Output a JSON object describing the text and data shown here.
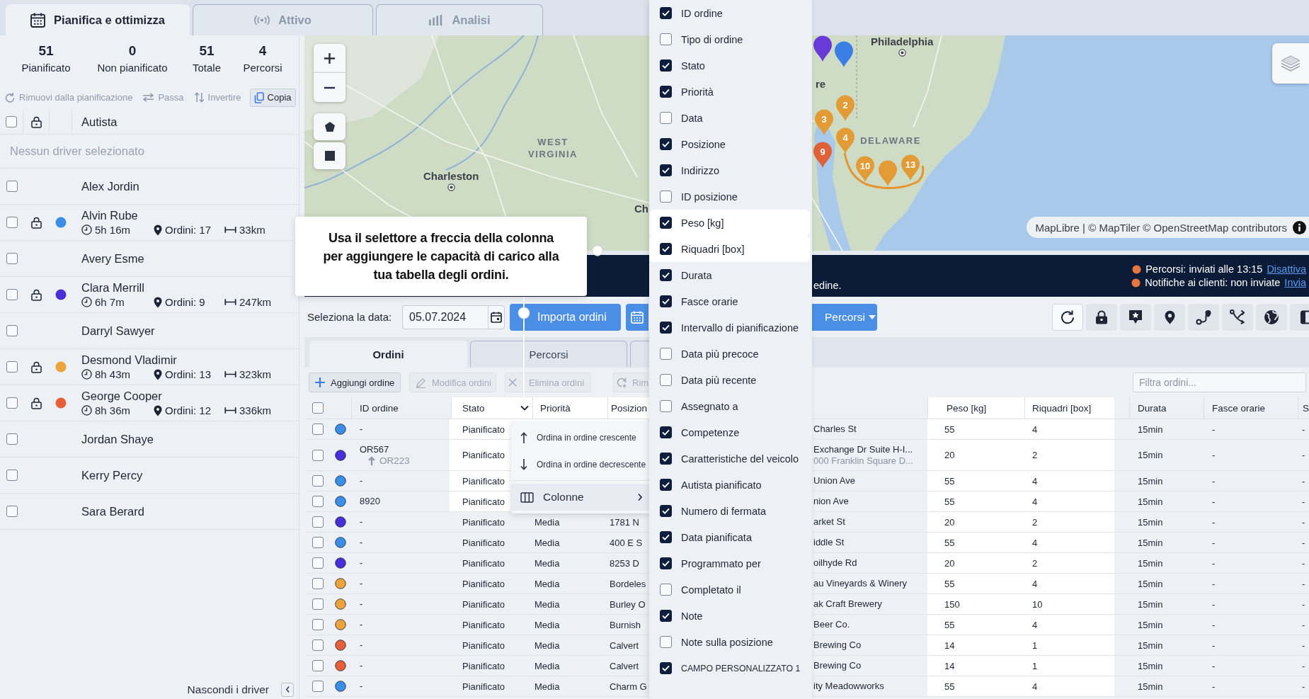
{
  "top_tabs": [
    {
      "label": "Pianifica e ottimizza",
      "selected": true
    },
    {
      "label": "Attivo",
      "selected": false
    },
    {
      "label": "Analisi",
      "selected": false
    }
  ],
  "summary": [
    {
      "value": "51",
      "label": "Pianificato"
    },
    {
      "value": "0",
      "label": "Non pianificato"
    },
    {
      "value": "51",
      "label": "Totale"
    },
    {
      "value": "4",
      "label": "Percorsi"
    }
  ],
  "driver_actions": [
    {
      "label": "Rimuovi dalla pianificazione",
      "disabled": true
    },
    {
      "label": "Passa",
      "disabled": true
    },
    {
      "label": "Invertire",
      "disabled": true
    },
    {
      "label": "Copia",
      "disabled": false
    }
  ],
  "drivers": {
    "all_checked": false,
    "column": "Autista",
    "placeholder": "Nessun driver selezionato",
    "hide_label": "Nascondi i driver",
    "rows": [
      {
        "name": "Alex Jordin",
        "checked": false
      },
      {
        "name": "Alvin Rube",
        "checked": false,
        "color": "#3a8ee6",
        "duration": "5h 16m",
        "orders": "Ordini: 17",
        "distance": "33km"
      },
      {
        "name": "Avery Esme",
        "checked": false
      },
      {
        "name": "Clara Merrill",
        "checked": false,
        "color": "#4a2fd8",
        "duration": "6h 7m",
        "orders": "Ordini: 9",
        "distance": "247km"
      },
      {
        "name": "Darryl Sawyer",
        "checked": false
      },
      {
        "name": "Desmond Vladimir",
        "checked": false,
        "color": "#eba33a",
        "duration": "8h 43m",
        "orders": "Ordini: 13",
        "distance": "323km"
      },
      {
        "name": "George Cooper",
        "checked": false,
        "color": "#e65f38",
        "duration": "8h 36m",
        "orders": "Ordini: 12",
        "distance": "336km"
      },
      {
        "name": "Jordan Shaye",
        "checked": false
      },
      {
        "name": "Kerry Percy",
        "checked": false
      },
      {
        "name": "Sara Berard",
        "checked": false
      }
    ]
  },
  "map": {
    "labels": [
      {
        "text": "Philadelphia",
        "kind": "city"
      },
      {
        "text": "WEST VIRGINIA",
        "kind": "region"
      },
      {
        "text": "Charleston",
        "kind": "city"
      },
      {
        "text": "Ch",
        "kind": "place"
      },
      {
        "text": "re",
        "kind": "place"
      },
      {
        "text": "DELAWARE",
        "kind": "region"
      }
    ],
    "markers": [
      {
        "label": "2",
        "color": "#e39b36"
      },
      {
        "label": "3",
        "color": "#e39b36"
      },
      {
        "label": "4",
        "color": "#e39b36"
      },
      {
        "label": "10",
        "color": "#e39b36"
      },
      {
        "label": "13",
        "color": "#e39b36"
      },
      {
        "label": "9",
        "color": "#e06038"
      },
      {
        "color": "#3a7fe6"
      },
      {
        "color": "#6a3ad8"
      },
      {
        "color": "#e39b36"
      }
    ],
    "attribution": "MapLibre | © MapTiler © OpenStreetMap contributors"
  },
  "banner": {
    "message": "edine.",
    "statuses": [
      {
        "text": "Percorsi: inviati alle 13:15",
        "link": "Disattiva"
      },
      {
        "text": "Notifiche ai clienti: non inviate",
        "link": "Invia"
      }
    ]
  },
  "toolbar": {
    "date_label": "Seleziona la data:",
    "date": "05.07.2024",
    "import_button": "Importa ordini",
    "routes_button": "Percorsi"
  },
  "order_tabs": [
    {
      "label": "Ordini",
      "selected": true
    },
    {
      "label": "Percorsi",
      "selected": false
    }
  ],
  "order_actions": [
    {
      "label": "Aggiungi ordine",
      "disabled": false
    },
    {
      "label": "Modifica ordini",
      "disabled": true
    },
    {
      "label": "Elimina ordini",
      "disabled": true
    },
    {
      "label": "Rim",
      "disabled": true
    }
  ],
  "filter": {
    "placeholder": "Filtra ordini..."
  },
  "table": {
    "all_checked": false,
    "columns": [
      {
        "label": "ID ordine",
        "highlighted": false,
        "menu_open": false
      },
      {
        "label": "Stato",
        "highlighted": true,
        "menu_open": true
      },
      {
        "label": "Priorità",
        "highlighted": true,
        "menu_open": false
      },
      {
        "label": "Posizion",
        "highlighted": true,
        "menu_open": false
      },
      {
        "label": "Peso [kg]",
        "highlighted": true,
        "menu_open": false
      },
      {
        "label": "Riquadri [box]",
        "highlighted": true,
        "menu_open": false
      },
      {
        "label": "Durata",
        "highlighted": false,
        "menu_open": false
      },
      {
        "label": "Fasce orarie",
        "highlighted": false,
        "menu_open": false
      },
      {
        "label": "S",
        "highlighted": false,
        "menu_open": false
      }
    ],
    "rows": [
      {
        "checked": false,
        "color": "#3a8ee6",
        "id_ordine": "-",
        "stato": "Pianificato",
        "column_7": "Charles St",
        "peso": "55",
        "riquadri": "4",
        "durata": "15min",
        "fasce_orarie": "-",
        "column_12": "-"
      },
      {
        "checked": false,
        "color": "#4a2fd8",
        "id_ordine": "OR567",
        "linked_id": "OR223",
        "stato": "Pianificato",
        "column_7": "Exchange Dr Suite H-I...",
        "column_7_line_2": "000 Franklin Square D...",
        "peso": "20",
        "riquadri": "2",
        "durata": "15min",
        "fasce_orarie": "-",
        "column_12": "-"
      },
      {
        "checked": false,
        "color": "#3a8ee6",
        "id_ordine": "-",
        "stato": "Pianificato",
        "column_7": "Union Ave",
        "peso": "55",
        "riquadri": "4",
        "durata": "15min",
        "fasce_orarie": "-",
        "column_12": "-"
      },
      {
        "checked": false,
        "color": "#3a8ee6",
        "id_ordine": "8920",
        "stato": "Pianificato",
        "column_7": "nion Ave",
        "peso": "55",
        "riquadri": "4",
        "durata": "15min",
        "fasce_orarie": "-",
        "column_12": "-"
      },
      {
        "checked": false,
        "color": "#4a2fd8",
        "id_ordine": "-",
        "stato": "Pianificato",
        "priorita": "Media",
        "posizione": "1781 N",
        "column_7": "arket St",
        "peso": "20",
        "riquadri": "2",
        "durata": "15min",
        "fasce_orarie": "-",
        "column_12": "-"
      },
      {
        "checked": false,
        "color": "#3a8ee6",
        "id_ordine": "-",
        "stato": "Pianificato",
        "priorita": "Media",
        "posizione": "400 E S",
        "column_7": "iddle St",
        "peso": "55",
        "riquadri": "4",
        "durata": "15min",
        "fasce_orarie": "-",
        "column_12": "-"
      },
      {
        "checked": false,
        "color": "#4a2fd8",
        "id_ordine": "-",
        "stato": "Pianificato",
        "priorita": "Media",
        "posizione": "8253 D",
        "column_7": "oilhyde Rd",
        "peso": "20",
        "riquadri": "2",
        "durata": "15min",
        "fasce_orarie": "-",
        "column_12": "-"
      },
      {
        "checked": false,
        "color": "#eba33a",
        "id_ordine": "-",
        "stato": "Pianificato",
        "priorita": "Media",
        "posizione": "Bordeles",
        "column_7": "au Vineyards & Winery",
        "peso": "55",
        "riquadri": "4",
        "durata": "15min",
        "fasce_orarie": "-",
        "column_12": "-"
      },
      {
        "checked": false,
        "color": "#eba33a",
        "id_ordine": "-",
        "stato": "Pianificato",
        "priorita": "Media",
        "posizione": "Burley O",
        "column_7": "ak Craft Brewery",
        "peso": "150",
        "riquadri": "10",
        "durata": "15min",
        "fasce_orarie": "-",
        "column_12": "-"
      },
      {
        "checked": false,
        "color": "#eba33a",
        "id_ordine": "-",
        "stato": "Pianificato",
        "priorita": "Media",
        "posizione": "Burnish",
        "column_7": "Beer Co.",
        "peso": "55",
        "riquadri": "4",
        "durata": "15min",
        "fasce_orarie": "-",
        "column_12": "-"
      },
      {
        "checked": false,
        "color": "#e65f38",
        "id_ordine": "-",
        "stato": "Pianificato",
        "priorita": "Media",
        "posizione": "Calvert",
        "column_7": "Brewing Co",
        "peso": "14",
        "riquadri": "1",
        "durata": "15min",
        "fasce_orarie": "-",
        "column_12": "-"
      },
      {
        "checked": false,
        "color": "#e65f38",
        "id_ordine": "-",
        "stato": "Pianificato",
        "priorita": "Media",
        "posizione": "Calvert",
        "column_7": "Brewing Co",
        "peso": "14",
        "riquadri": "1",
        "durata": "15min",
        "fasce_orarie": "-",
        "column_12": "-"
      },
      {
        "checked": false,
        "color": "#3a8ee6",
        "id_ordine": "-",
        "stato": "Pianificato",
        "priorita": "Media",
        "posizione": "Charm G",
        "column_7": "ity Meadowworks",
        "peso": "55",
        "riquadri": "4",
        "durata": "15min",
        "fasce_orarie": "-",
        "column_12": "-"
      }
    ]
  },
  "column_menu": [
    {
      "label": "Ordina in ordine crescente",
      "kind": "sort_asc",
      "highlighted": false
    },
    {
      "label": "Ordina in ordine decrescente",
      "kind": "sort_desc",
      "highlighted": false
    },
    {
      "label": "Colonne",
      "kind": "submenu",
      "highlighted": true
    }
  ],
  "columns_menu": [
    {
      "label": "ID ordine",
      "checked": true,
      "highlighted": false,
      "kind": "standard"
    },
    {
      "label": "Tipo di ordine",
      "checked": false,
      "highlighted": false,
      "kind": "standard"
    },
    {
      "label": "Stato",
      "checked": true,
      "highlighted": false,
      "kind": "standard"
    },
    {
      "label": "Priorità",
      "checked": true,
      "highlighted": false,
      "kind": "standard"
    },
    {
      "label": "Data",
      "checked": false,
      "highlighted": false,
      "kind": "standard"
    },
    {
      "label": "Posizione",
      "checked": true,
      "highlighted": false,
      "kind": "standard"
    },
    {
      "label": "Indirizzo",
      "checked": true,
      "highlighted": false,
      "kind": "standard"
    },
    {
      "label": "ID posizione",
      "checked": false,
      "highlighted": false,
      "kind": "standard"
    },
    {
      "label": "Peso [kg]",
      "checked": true,
      "highlighted": true,
      "kind": "standard"
    },
    {
      "label": "Riquadri [box]",
      "checked": true,
      "highlighted": true,
      "kind": "standard"
    },
    {
      "label": "Durata",
      "checked": true,
      "highlighted": false,
      "kind": "standard"
    },
    {
      "label": "Fasce orarie",
      "checked": true,
      "highlighted": false,
      "kind": "standard"
    },
    {
      "label": "Intervallo di pianificazione",
      "checked": true,
      "highlighted": false,
      "kind": "standard"
    },
    {
      "label": "Data più precoce",
      "checked": false,
      "highlighted": false,
      "kind": "standard"
    },
    {
      "label": "Data più recente",
      "checked": false,
      "highlighted": false,
      "kind": "standard"
    },
    {
      "label": "Assegnato a",
      "checked": false,
      "highlighted": false,
      "kind": "standard"
    },
    {
      "label": "Competenze",
      "checked": true,
      "highlighted": false,
      "kind": "standard"
    },
    {
      "label": "Caratteristiche del veicolo",
      "checked": true,
      "highlighted": false,
      "kind": "standard"
    },
    {
      "label": "Autista pianificato",
      "checked": true,
      "highlighted": false,
      "kind": "standard"
    },
    {
      "label": "Numero di fermata",
      "checked": true,
      "highlighted": false,
      "kind": "standard"
    },
    {
      "label": "Data pianificata",
      "checked": true,
      "highlighted": false,
      "kind": "standard"
    },
    {
      "label": "Programmato per",
      "checked": true,
      "highlighted": false,
      "kind": "standard"
    },
    {
      "label": "Completato il",
      "checked": false,
      "highlighted": false,
      "kind": "standard"
    },
    {
      "label": "Note",
      "checked": true,
      "highlighted": false,
      "kind": "standard"
    },
    {
      "label": "Note sulla posizione",
      "checked": false,
      "highlighted": false,
      "kind": "standard"
    },
    {
      "label": "CAMPO PERSONALIZZATO 1",
      "checked": true,
      "highlighted": false,
      "kind": "custom"
    }
  ],
  "tour": {
    "text": "Usa il selettore a freccia della colonna per aggiungere le capacità di carico alla tua tabella degli ordini."
  }
}
